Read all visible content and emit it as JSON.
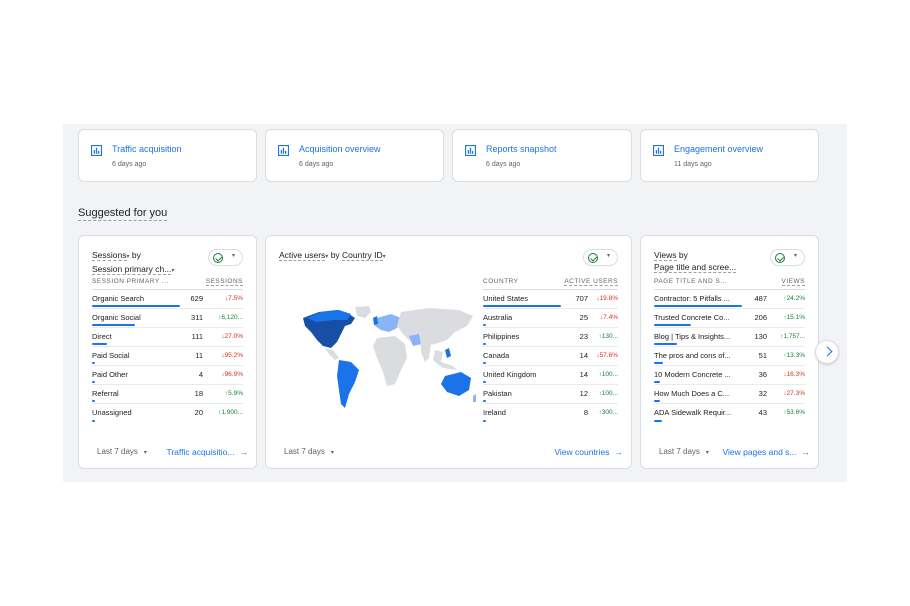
{
  "recent": [
    {
      "title": "Traffic acquisition",
      "time": "6 days ago"
    },
    {
      "title": "Acquisition overview",
      "time": "6 days ago"
    },
    {
      "title": "Reports snapshot",
      "time": "6 days ago"
    },
    {
      "title": "Engagement overview",
      "time": "11 days ago"
    }
  ],
  "section_title": "Suggested for you",
  "sessions_card": {
    "title_metric": "Sessions",
    "title_by": "by",
    "title_dim": "Session primary ch...",
    "col1": "SESSION PRIMARY ...",
    "col2": "SESSIONS",
    "rows": [
      {
        "label": "Organic Search",
        "value": "629",
        "change": "7.5%",
        "dir": "down",
        "bar": 1.0
      },
      {
        "label": "Organic Social",
        "value": "311",
        "change": "6,120...",
        "dir": "up",
        "bar": 0.494
      },
      {
        "label": "Direct",
        "value": "111",
        "change": "27.0%",
        "dir": "down",
        "bar": 0.176
      },
      {
        "label": "Paid Social",
        "value": "11",
        "change": "95.2%",
        "dir": "down",
        "bar": 0.017
      },
      {
        "label": "Paid Other",
        "value": "4",
        "change": "96.9%",
        "dir": "down",
        "bar": 0.006
      },
      {
        "label": "Referral",
        "value": "18",
        "change": "5.9%",
        "dir": "up",
        "bar": 0.029
      },
      {
        "label": "Unassigned",
        "value": "20",
        "change": "1,900...",
        "dir": "up",
        "bar": 0.032
      }
    ],
    "range": "Last 7 days",
    "link": "Traffic acquisitio..."
  },
  "users_card": {
    "title_metric": "Active users",
    "title_by": "by",
    "title_dim": "Country ID",
    "col1": "COUNTRY",
    "col2": "ACTIVE USERS",
    "rows": [
      {
        "label": "United States",
        "value": "707",
        "change": "19.8%",
        "dir": "down",
        "bar": 1.0
      },
      {
        "label": "Australia",
        "value": "25",
        "change": "7.4%",
        "dir": "down",
        "bar": 0.035
      },
      {
        "label": "Philippines",
        "value": "23",
        "change": "130...",
        "dir": "up",
        "bar": 0.033
      },
      {
        "label": "Canada",
        "value": "14",
        "change": "57.6%",
        "dir": "down",
        "bar": 0.02
      },
      {
        "label": "United Kingdom",
        "value": "14",
        "change": "100...",
        "dir": "up",
        "bar": 0.02
      },
      {
        "label": "Pakistan",
        "value": "12",
        "change": "100...",
        "dir": "up",
        "bar": 0.017
      },
      {
        "label": "Ireland",
        "value": "8",
        "change": "300...",
        "dir": "up",
        "bar": 0.011
      }
    ],
    "range": "Last 7 days",
    "link": "View countries"
  },
  "views_card": {
    "title_metric": "Views",
    "title_by": "by",
    "title_dim": "Page title and scree...",
    "col1": "PAGE TITLE AND S...",
    "col2": "VIEWS",
    "rows": [
      {
        "label": "Contractor: 5 Pitfalls ...",
        "value": "487",
        "change": "24.2%",
        "dir": "up",
        "bar": 1.0
      },
      {
        "label": "Trusted Concrete Co...",
        "value": "206",
        "change": "15.1%",
        "dir": "up",
        "bar": 0.423
      },
      {
        "label": "Blog | Tips & Insights...",
        "value": "130",
        "change": "1,757...",
        "dir": "up",
        "bar": 0.267
      },
      {
        "label": "The pros and cons of...",
        "value": "51",
        "change": "13.3%",
        "dir": "up",
        "bar": 0.105
      },
      {
        "label": "10 Modern Concrete ...",
        "value": "36",
        "change": "16.3%",
        "dir": "down",
        "bar": 0.074
      },
      {
        "label": "How Much Does a C...",
        "value": "32",
        "change": "27.3%",
        "dir": "down",
        "bar": 0.066
      },
      {
        "label": "ADA Sidewalk Requir...",
        "value": "43",
        "change": "53.6%",
        "dir": "up",
        "bar": 0.088
      }
    ],
    "range": "Last 7 days",
    "link": "View pages and s..."
  },
  "arrows": {
    "up": "↑",
    "down": "↓",
    "right": "→",
    "caret": "▾"
  },
  "colors": {
    "accent": "#1a73e8",
    "up": "#188038",
    "down": "#d93025",
    "map_high": "#174ea6",
    "map_mid": "#1a73e8",
    "map_low": "#8ab4f8",
    "map_none": "#dadce0"
  },
  "icons": {
    "report": "bar-chart-icon",
    "status": "check-circle-icon",
    "next": "chevron-right-icon"
  }
}
